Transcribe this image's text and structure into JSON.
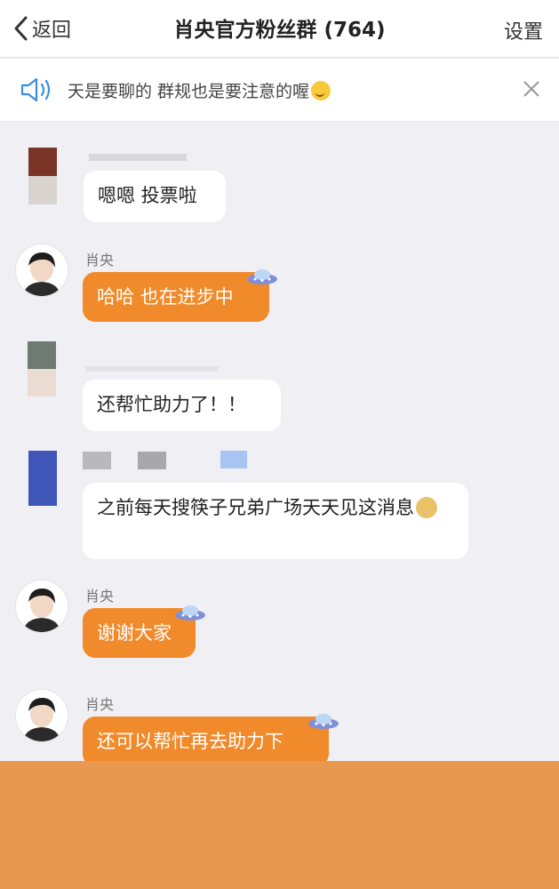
{
  "nav": {
    "back_label": "返回",
    "title": "肖央官方粉丝群 (764)",
    "settings_label": "设置"
  },
  "notice": {
    "text": "天是要聊的 群规也是要注意的喔"
  },
  "messages": [
    {
      "sender": "",
      "text": "嗯嗯 投票啦"
    },
    {
      "sender": "肖央",
      "text": "哈哈 也在进步中"
    },
    {
      "sender": "",
      "text": "还帮忙助力了！！"
    },
    {
      "sender": "",
      "text": "之前每天搜筷子兄弟广场天天见这消息"
    },
    {
      "sender": "肖央",
      "text": "谢谢大家"
    },
    {
      "sender": "肖央",
      "text": "还可以帮忙再去助力下"
    }
  ],
  "colors": {
    "orange_bubble": "#f08a2a",
    "bottom_cover": "#e8984f",
    "chat_bg": "#efeff4"
  },
  "icons": {
    "back": "chevron-left-icon",
    "speaker": "speaker-icon",
    "close": "close-icon",
    "badge": "ufo-badge-icon"
  }
}
